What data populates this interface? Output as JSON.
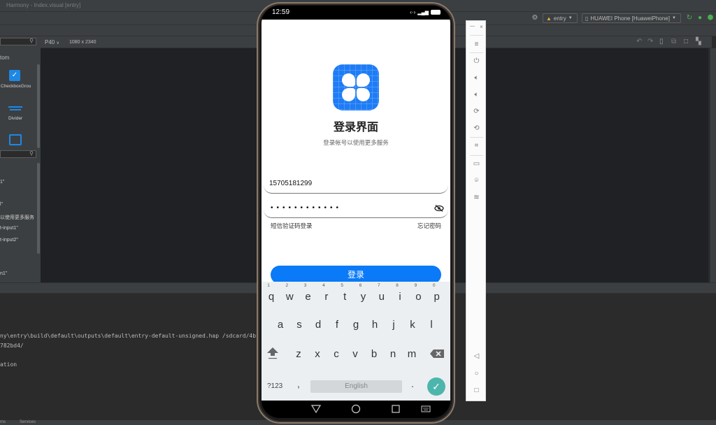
{
  "ide": {
    "window_title": "Harmony - Index.visual [entry]",
    "toolbar": {
      "module_selector": "entry",
      "device_selector": "HUAWEI Phone [HuaweiPhone]"
    },
    "canvas": {
      "device_model": "P40",
      "resolution": "1080 x 2340"
    },
    "left_panel": {
      "section_label": "tom",
      "components": [
        {
          "label": "CheckboxGrou",
          "icon": "checkbox-icon"
        },
        {
          "label": "Divider",
          "icon": "divider-icon"
        },
        {
          "label": "",
          "icon": "grid-icon"
        }
      ],
      "tree_items": [
        "1\"",
        "l\"",
        "以使用更多服务",
        "t-input1\"",
        "t-input2\"",
        "n1\""
      ]
    },
    "run_log": [
      "ny\\entry\\build\\default\\outputs\\default\\entry-default-unsigned.hap /sdcard/4b",
      "782bd4/",
      "ation"
    ],
    "statusbar": [
      "ms",
      "Services"
    ]
  },
  "phone": {
    "status": {
      "time": "12:59"
    },
    "app": {
      "title": "登录界面",
      "subtitle": "登录帐号以使用更多服务",
      "account_value": "15705181299",
      "password_mask": "••••••••••••",
      "sms_login_link": "短信验证码登录",
      "forgot_password_link": "忘记密码",
      "login_button": "登录"
    },
    "keyboard": {
      "row1": [
        {
          "k": "q",
          "n": "1"
        },
        {
          "k": "w",
          "n": "2"
        },
        {
          "k": "e",
          "n": "3"
        },
        {
          "k": "r",
          "n": "4"
        },
        {
          "k": "t",
          "n": "5"
        },
        {
          "k": "y",
          "n": "6"
        },
        {
          "k": "u",
          "n": "7"
        },
        {
          "k": "i",
          "n": "8"
        },
        {
          "k": "o",
          "n": "9"
        },
        {
          "k": "p",
          "n": "0"
        }
      ],
      "row2": [
        "a",
        "s",
        "d",
        "f",
        "g",
        "h",
        "j",
        "k",
        "l"
      ],
      "row3": [
        "z",
        "x",
        "c",
        "v",
        "b",
        "n",
        "m"
      ],
      "symbols_key": "?123",
      "comma_key": ",",
      "space_key": "English",
      "period_key": ".",
      "enter_key": "✓"
    }
  },
  "colors": {
    "primary_blue": "#0a7af8",
    "enter_green": "#4db6ac"
  }
}
